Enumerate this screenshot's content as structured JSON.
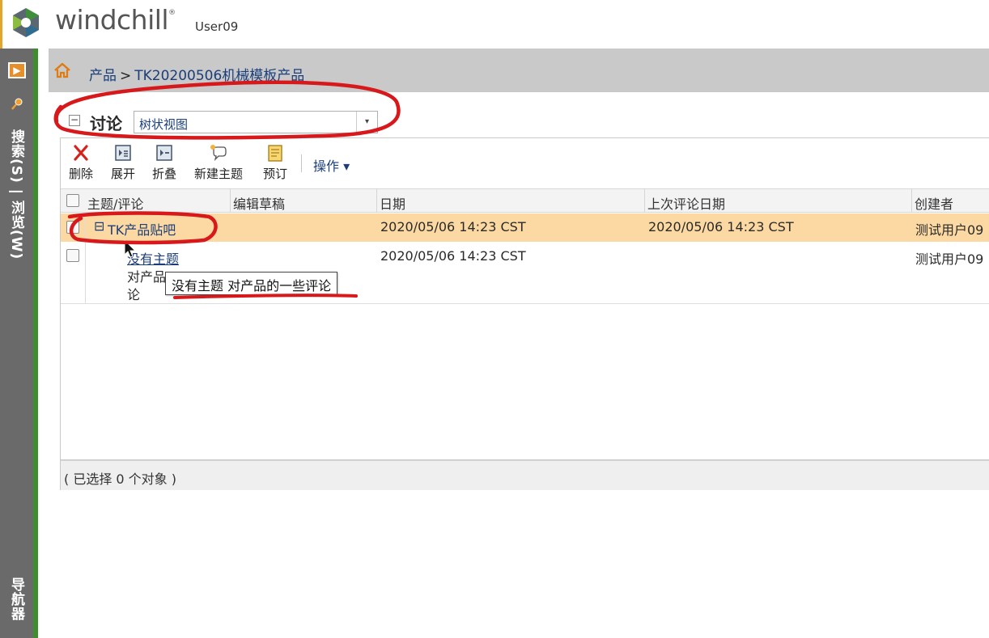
{
  "app": {
    "logo_text": "windchill",
    "logo_mark_symbol": "®",
    "user": "User09"
  },
  "navigator": {
    "toggle_glyph": "▶",
    "search_label": "搜索(S) | 浏览(W)",
    "navigator_label": "导航器",
    "accent": "#3e8e2e"
  },
  "breadcrumb": {
    "root": "产品",
    "separator": ">",
    "current": "TK20200506机械模板产品"
  },
  "discussion": {
    "title": "讨论",
    "collapse_glyph": "−",
    "view_select": {
      "value": "树状视图",
      "arrow": "▾"
    },
    "toolbar": {
      "delete": "删除",
      "expand": "展开",
      "collapse": "折叠",
      "new_topic": "新建主题",
      "subscribe": "预订",
      "actions": "操作 ▾"
    },
    "columns": [
      "主题/评论",
      "编辑草稿",
      "日期",
      "上次评论日期",
      "创建者"
    ],
    "rows": [
      {
        "expander": "⊟",
        "topic": "TK产品贴吧",
        "draft": "",
        "date": "2020/05/06 14:23 CST",
        "last_comment_date": "2020/05/06 14:23 CST",
        "creator": "测试用户09",
        "selected": true
      },
      {
        "topic": "没有主题",
        "comment_line1": "对产品",
        "comment_line2": "论",
        "draft": "",
        "date": "2020/05/06 14:23 CST",
        "last_comment_date": "",
        "creator": "测试用户09",
        "selected": false
      }
    ],
    "status": "( 已选择 0 个对象 )",
    "tooltip": "没有主题 对产品的一些评论"
  },
  "colors": {
    "selected_row": "#fcd9a2",
    "link": "#1b3e7a",
    "annotation": "#d7191c",
    "navigator_bg": "#6a6a6a"
  }
}
